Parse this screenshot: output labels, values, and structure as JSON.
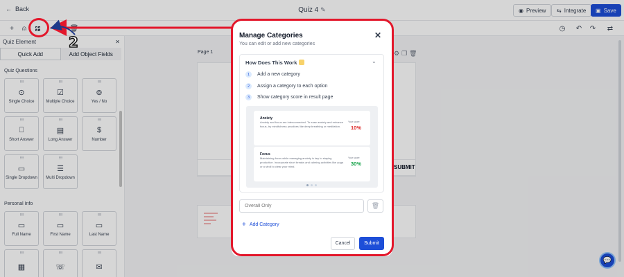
{
  "topbar": {
    "back_label": "Back",
    "quiz_title": "Quiz 4",
    "preview_label": "Preview",
    "integrate_label": "Integrate",
    "save_label": "Save"
  },
  "left_panel": {
    "title": "Quiz Element",
    "tabs": [
      "Quick Add",
      "Add Object Fields"
    ],
    "sections": [
      {
        "title": "Quiz Questions",
        "items": [
          {
            "label": "Single Choice",
            "icon": "single-choice-icon"
          },
          {
            "label": "Multiple Choice",
            "icon": "multiple-choice-icon"
          },
          {
            "label": "Yes / No",
            "icon": "yes-no-icon"
          },
          {
            "label": "Short Answer",
            "icon": "short-answer-icon"
          },
          {
            "label": "Long Answer",
            "icon": "long-answer-icon"
          },
          {
            "label": "Number",
            "icon": "number-icon"
          },
          {
            "label": "Single Dropdown",
            "icon": "single-dropdown-icon"
          },
          {
            "label": "Multi Dropdown",
            "icon": "multi-dropdown-icon"
          }
        ]
      },
      {
        "title": "Personal Info",
        "items": [
          {
            "label": "Full Name",
            "icon": "id-card-icon"
          },
          {
            "label": "First Name",
            "icon": "id-card-icon"
          },
          {
            "label": "Last Name",
            "icon": "id-card-icon"
          }
        ]
      }
    ]
  },
  "canvas": {
    "page_label": "Page 1",
    "submit_label": "SUBMIT"
  },
  "modal": {
    "title": "Manage Categories",
    "subtitle": "You can edit or add new categories",
    "how_title": "How Does This Work",
    "steps": [
      {
        "num": "1",
        "text": "Add a new category"
      },
      {
        "num": "2",
        "text": "Assign a category to each option"
      },
      {
        "num": "3",
        "text": "Show category score in result page"
      }
    ],
    "preview_cards": [
      {
        "title": "Anxiety",
        "text": "Anxiety and focus are interconnected. To ease anxiety and enhance focus, try mindfulness practices like deep breathing or meditation.",
        "score_label": "Your score",
        "score": "10%",
        "color": "#dc2626"
      },
      {
        "title": "Focus",
        "text": "Maintaining focus while managing anxiety is key to staying productive. Incorporate short breaks and calming activities like yoga or a stroll to clear your mind.",
        "score_label": "Your score",
        "score": "30%",
        "color": "#16a34a"
      }
    ],
    "input_placeholder": "Overall Only",
    "add_label": "Add Category",
    "cancel_label": "Cancel",
    "submit_label": "Submit"
  },
  "annotation": {
    "number": "2",
    "color": "#e3172b"
  },
  "colors": {
    "primary": "#1d4ed8",
    "annotation_red": "#e3172b"
  }
}
